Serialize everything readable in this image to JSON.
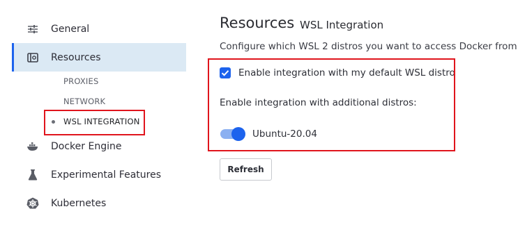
{
  "sidebar": {
    "items": [
      {
        "label": "General",
        "icon": "sliders-icon"
      },
      {
        "label": "Resources",
        "icon": "resources-icon",
        "active": true
      },
      {
        "label": "Docker Engine",
        "icon": "whale-icon"
      },
      {
        "label": "Experimental Features",
        "icon": "flask-icon"
      },
      {
        "label": "Kubernetes",
        "icon": "helm-wheel-icon"
      }
    ],
    "subitems": [
      {
        "label": "PROXIES"
      },
      {
        "label": "NETWORK"
      },
      {
        "label": "WSL INTEGRATION",
        "current": true
      }
    ]
  },
  "main": {
    "title": "Resources",
    "subtitle": "WSL Integration",
    "description": "Configure which WSL 2 distros you want to access Docker from",
    "default_distro_label": "Enable integration with my default WSL distro",
    "default_distro_checked": true,
    "additional_label": "Enable integration with additional distros:",
    "distros": [
      {
        "name": "Ubuntu-20.04",
        "enabled": true
      }
    ],
    "refresh_label": "Refresh"
  },
  "colors": {
    "accent": "#1d63ed",
    "active_bg": "#dbe9f4",
    "highlight_box": "#e0141c"
  }
}
